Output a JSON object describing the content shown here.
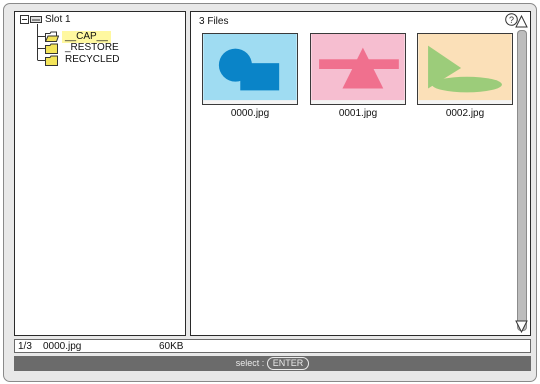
{
  "tree": {
    "root": "Slot 1",
    "folders": [
      {
        "label": "__CAP__",
        "selected": true
      },
      {
        "label": "_RESTORE",
        "selected": false
      },
      {
        "label": "RECYCLED",
        "selected": false
      }
    ]
  },
  "files": {
    "count_label": "3 Files",
    "items": [
      {
        "name": "0000.jpg",
        "bg": "#9fdcf2"
      },
      {
        "name": "0001.jpg",
        "bg": "#f6bed0"
      },
      {
        "name": "0002.jpg",
        "bg": "#fbe0b8"
      }
    ]
  },
  "status": {
    "position": "1/3",
    "filename": "0000.jpg",
    "size": "60KB"
  },
  "footer": {
    "select_label": "select :",
    "key_label": "ENTER"
  },
  "icons": {
    "help": "help-icon",
    "drive": "drive-icon",
    "folder": "folder-icon",
    "scroll_up": "scroll-up-icon",
    "scroll_down": "scroll-down-icon"
  }
}
